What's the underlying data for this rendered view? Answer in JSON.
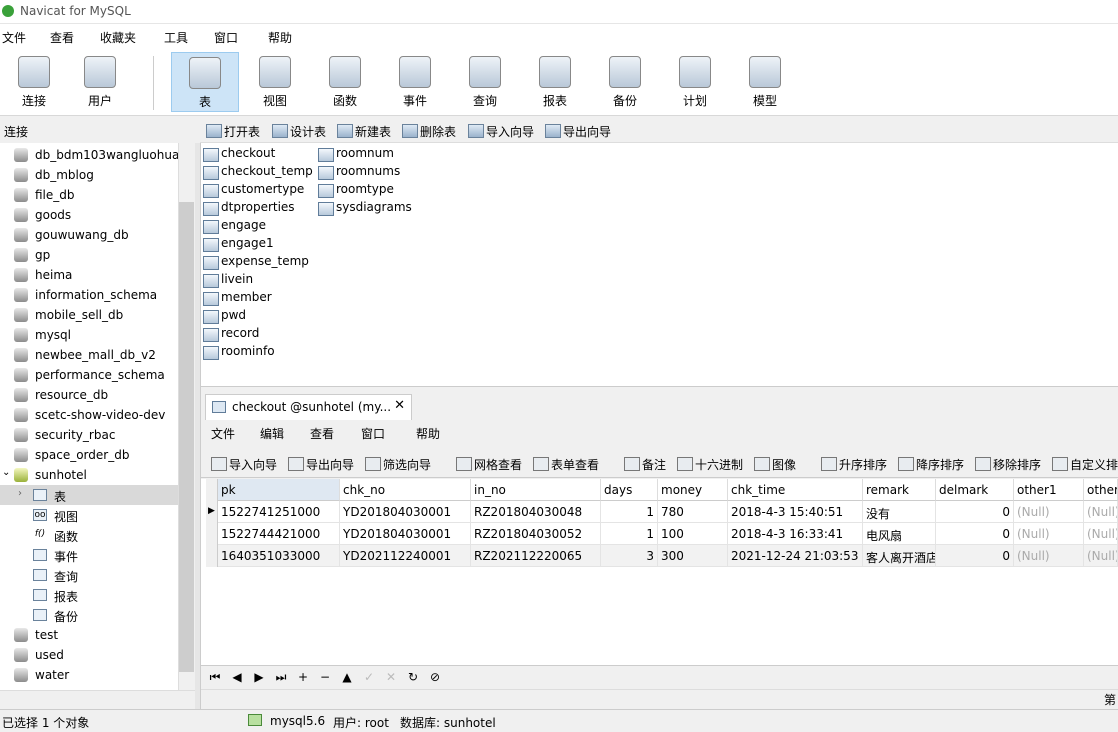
{
  "app": {
    "title": "Navicat for MySQL"
  },
  "menu": [
    "文件",
    "查看",
    "收藏夹",
    "工具",
    "窗口",
    "帮助"
  ],
  "toolbar": [
    {
      "label": "连接",
      "icon": "connection-icon"
    },
    {
      "label": "用户",
      "icon": "user-icon"
    },
    {
      "label": "表",
      "icon": "table-icon",
      "active": true
    },
    {
      "label": "视图",
      "icon": "view-icon"
    },
    {
      "label": "函数",
      "icon": "function-icon"
    },
    {
      "label": "事件",
      "icon": "event-icon"
    },
    {
      "label": "查询",
      "icon": "query-icon"
    },
    {
      "label": "报表",
      "icon": "report-icon"
    },
    {
      "label": "备份",
      "icon": "backup-icon"
    },
    {
      "label": "计划",
      "icon": "schedule-icon"
    },
    {
      "label": "模型",
      "icon": "model-icon"
    }
  ],
  "connection_header": "连接",
  "object_toolbar": [
    "打开表",
    "设计表",
    "新建表",
    "删除表",
    "导入向导",
    "导出向导"
  ],
  "tree": {
    "databases_before": [
      "db_bdm103wangluohua",
      "db_mblog",
      "file_db",
      "goods",
      "gouwuwang_db",
      "gp",
      "heima",
      "information_schema",
      "mobile_sell_db",
      "mysql",
      "newbee_mall_db_v2",
      "performance_schema",
      "resource_db",
      "scetc-show-video-dev",
      "security_rbac",
      "space_order_db"
    ],
    "current_db": "sunhotel",
    "children": [
      "表",
      "视图",
      "函数",
      "事件",
      "查询",
      "报表",
      "备份"
    ],
    "databases_after": [
      "test",
      "used",
      "water"
    ]
  },
  "tables_col1": [
    "checkout",
    "checkout_temp",
    "customertype",
    "dtproperties",
    "engage",
    "engage1",
    "expense_temp",
    "livein",
    "member",
    "pwd",
    "record",
    "roominfo"
  ],
  "tables_col2": [
    "roomnum",
    "roomnums",
    "roomtype",
    "sysdiagrams"
  ],
  "tab": {
    "label": "checkout @sunhotel (my...",
    "close": "✕"
  },
  "submenu": [
    "文件",
    "编辑",
    "查看",
    "窗口",
    "帮助"
  ],
  "grid_toolbar": [
    "导入向导",
    "导出向导",
    "筛选向导",
    "网格查看",
    "表单查看",
    "备注",
    "十六进制",
    "图像",
    "升序排序",
    "降序排序",
    "移除排序",
    "自定义排"
  ],
  "grid": {
    "columns": [
      "pk",
      "chk_no",
      "in_no",
      "days",
      "money",
      "chk_time",
      "remark",
      "delmark",
      "other1",
      "other"
    ],
    "rows": [
      [
        "1522741251000",
        "YD201804030001",
        "RZ201804030048",
        "1",
        "780",
        "2018-4-3 15:40:51",
        "没有",
        "0",
        "(Null)",
        "(Null)"
      ],
      [
        "1522744421000",
        "YD201804030001",
        "RZ201804030052",
        "1",
        "100",
        "2018-4-3 16:33:41",
        "电风扇",
        "0",
        "(Null)",
        "(Null)"
      ],
      [
        "1640351033000",
        "YD202112240001",
        "RZ202112220065",
        "3",
        "300",
        "2021-12-24 21:03:53",
        "客人离开酒店",
        "0",
        "(Null)",
        "(Null)"
      ]
    ]
  },
  "nav_buttons": [
    "⏮",
    "◀",
    "▶",
    "⏭",
    "+",
    "−",
    "▲",
    "✓",
    "✕",
    "↻",
    "⊘"
  ],
  "status": {
    "selection": "已选择 1 个对象",
    "server": "mysql5.6",
    "user": "用户: root",
    "database": "数据库: sunhotel",
    "right": "第"
  },
  "colors": {
    "active_toolbar": "#cde4f7",
    "selected_tree": "#d9d9d9"
  }
}
